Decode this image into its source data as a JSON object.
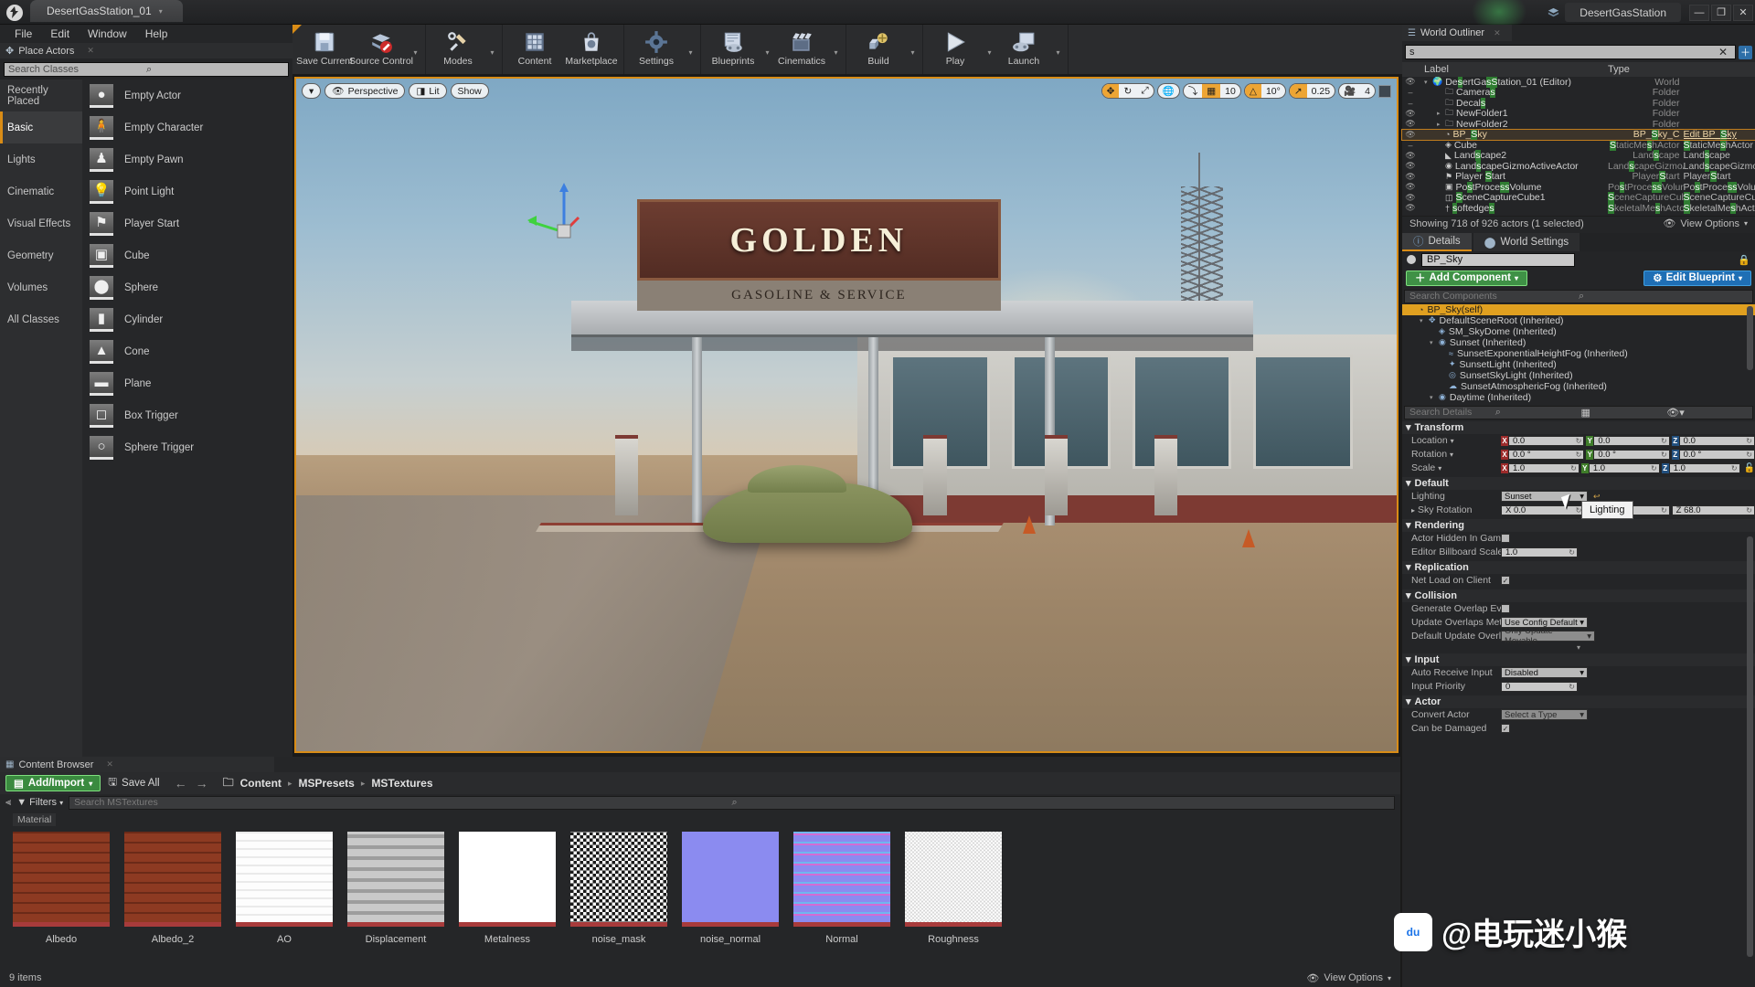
{
  "titlebar": {
    "tab_label": "DesertGasStation_01",
    "project_name": "DesertGasStation",
    "minimize": "—",
    "maximize": "❐",
    "close": "✕",
    "ue_logo_icon": "unreal-logo-icon"
  },
  "menubar": {
    "items": [
      "File",
      "Edit",
      "Window",
      "Help"
    ]
  },
  "toolbar": {
    "groups": [
      {
        "buttons": [
          {
            "label": "Save Current",
            "icon": "save-icon",
            "arrow": false
          },
          {
            "label": "Source Control",
            "icon": "source-control-icon",
            "arrow": true
          }
        ]
      },
      {
        "buttons": [
          {
            "label": "Modes",
            "icon": "modes-icon",
            "arrow": true
          }
        ]
      },
      {
        "buttons": [
          {
            "label": "Content",
            "icon": "content-icon",
            "arrow": false
          },
          {
            "label": "Marketplace",
            "icon": "marketplace-icon",
            "arrow": false
          }
        ]
      },
      {
        "buttons": [
          {
            "label": "Settings",
            "icon": "settings-icon",
            "arrow": true
          }
        ]
      },
      {
        "buttons": [
          {
            "label": "Blueprints",
            "icon": "blueprints-icon",
            "arrow": true
          },
          {
            "label": "Cinematics",
            "icon": "cinematics-icon",
            "arrow": true
          }
        ]
      },
      {
        "buttons": [
          {
            "label": "Build",
            "icon": "build-icon",
            "arrow": true
          }
        ]
      },
      {
        "buttons": [
          {
            "label": "Play",
            "icon": "play-icon",
            "arrow": true
          },
          {
            "label": "Launch",
            "icon": "launch-icon",
            "arrow": true
          }
        ]
      }
    ]
  },
  "place_actors": {
    "title": "Place Actors",
    "search_placeholder": "Search Classes",
    "categories": [
      {
        "label": "Recently Placed",
        "selected": false
      },
      {
        "label": "Basic",
        "selected": true
      },
      {
        "label": "Lights",
        "selected": false
      },
      {
        "label": "Cinematic",
        "selected": false
      },
      {
        "label": "Visual Effects",
        "selected": false
      },
      {
        "label": "Geometry",
        "selected": false
      },
      {
        "label": "Volumes",
        "selected": false
      },
      {
        "label": "All Classes",
        "selected": false
      }
    ],
    "items": [
      {
        "label": "Empty Actor",
        "glyph": "●"
      },
      {
        "label": "Empty Character",
        "glyph": "🧍"
      },
      {
        "label": "Empty Pawn",
        "glyph": "♟"
      },
      {
        "label": "Point Light",
        "glyph": "💡"
      },
      {
        "label": "Player Start",
        "glyph": "⚑"
      },
      {
        "label": "Cube",
        "glyph": "▣"
      },
      {
        "label": "Sphere",
        "glyph": "⬤"
      },
      {
        "label": "Cylinder",
        "glyph": "▮"
      },
      {
        "label": "Cone",
        "glyph": "▲"
      },
      {
        "label": "Plane",
        "glyph": "▬"
      },
      {
        "label": "Box Trigger",
        "glyph": "◻"
      },
      {
        "label": "Sphere Trigger",
        "glyph": "○"
      }
    ]
  },
  "viewport": {
    "left_controls": {
      "menu_caret": "▾",
      "perspective": "Perspective",
      "lit": "Lit",
      "show": "Show"
    },
    "right_controls": {
      "translate_icon": "translate-gizmo-icon",
      "rotate_icon": "rotate-gizmo-icon",
      "scale_icon": "scale-gizmo-icon",
      "world_icon": "world-space-icon",
      "surface_snap_icon": "surface-snap-icon",
      "grid_snap_icon": "grid-snap-icon",
      "grid_snap_value": "10",
      "angle_snap_icon": "angle-snap-icon",
      "angle_snap_value": "10°",
      "scale_snap_icon": "scale-snap-icon",
      "scale_snap_value": "0.25",
      "camera_speed_icon": "camera-speed-icon",
      "camera_speed_value": "4",
      "maximize_icon": "maximize-viewport-icon"
    },
    "scene": {
      "sign_text": "GOLDEN",
      "sign_sub": "GASOLINE & SERVICE"
    }
  },
  "content_browser": {
    "tab_title": "Content Browser",
    "add_import": "Add/Import",
    "save_all": "Save All",
    "breadcrumb": [
      "Content",
      "MSPresets",
      "MSTextures"
    ],
    "filters_label": "Filters",
    "search_placeholder": "Search MSTextures",
    "section_label": "Material",
    "assets": [
      {
        "name": "Albedo",
        "style": "brick"
      },
      {
        "name": "Albedo_2",
        "style": "brick"
      },
      {
        "name": "AO",
        "style": "ao"
      },
      {
        "name": "Displacement",
        "style": "disp"
      },
      {
        "name": "Metalness",
        "style": "white"
      },
      {
        "name": "noise_mask",
        "style": "noise"
      },
      {
        "name": "noise_normal",
        "style": "periwinkle"
      },
      {
        "name": "Normal",
        "style": "normal"
      },
      {
        "name": "Roughness",
        "style": "rough"
      }
    ],
    "item_count": "9 items",
    "view_options": "View Options"
  },
  "world_outliner": {
    "tab_title": "World Outliner",
    "search_value": "s",
    "clear_icon": "clear-search-icon",
    "add_icon": "add-outliner-icon",
    "columns": {
      "label": "Label",
      "type": "Type"
    },
    "rows": [
      {
        "label": "DesertGasStation_01 (Editor)",
        "type": "World",
        "type2": "",
        "icon": "world-icon",
        "indent": 0,
        "eye": true,
        "expander": "▾",
        "selected": false
      },
      {
        "label": "Cameras",
        "type": "Folder",
        "type2": "",
        "icon": "folder-icon",
        "indent": 1,
        "eye": false,
        "expander": "",
        "selected": false
      },
      {
        "label": "Decals",
        "type": "Folder",
        "type2": "",
        "icon": "folder-icon",
        "indent": 1,
        "eye": false,
        "expander": "",
        "selected": false
      },
      {
        "label": "NewFolder1",
        "type": "Folder",
        "type2": "",
        "icon": "folder-icon",
        "indent": 1,
        "eye": true,
        "expander": "▸",
        "selected": false
      },
      {
        "label": "NewFolder2",
        "type": "Folder",
        "type2": "",
        "icon": "folder-icon",
        "indent": 1,
        "eye": true,
        "expander": "▸",
        "selected": false
      },
      {
        "label": "BP_Sky",
        "type": "BP_Sky_C",
        "type2": "Edit BP_Sky",
        "icon": "blueprint-icon",
        "indent": 1,
        "eye": true,
        "expander": "",
        "selected": true
      },
      {
        "label": "Cube",
        "type": "StaticMeshActor",
        "type2": "StaticMeshActor",
        "icon": "mesh-icon",
        "indent": 1,
        "eye": false,
        "expander": "",
        "selected": false
      },
      {
        "label": "Landscape2",
        "type": "Landscape",
        "type2": "Landscape",
        "icon": "landscape-icon",
        "indent": 1,
        "eye": true,
        "expander": "",
        "selected": false
      },
      {
        "label": "LandscapeGizmoActiveActor",
        "type": "LandscapeGizmoActiveActor",
        "type2": "LandscapeGizmoActiveA",
        "icon": "gizmo-icon",
        "indent": 1,
        "eye": true,
        "expander": "",
        "selected": false
      },
      {
        "label": "Player Start",
        "type": "PlayerStart",
        "type2": "PlayerStart",
        "icon": "playerstart-icon",
        "indent": 1,
        "eye": true,
        "expander": "",
        "selected": false
      },
      {
        "label": "PostProcessVolume",
        "type": "PostProcessVolume",
        "type2": "PostProcessVolume",
        "icon": "volume-icon",
        "indent": 1,
        "eye": true,
        "expander": "",
        "selected": false
      },
      {
        "label": "SceneCaptureCube1",
        "type": "SceneCaptureCube",
        "type2": "SceneCaptureCube",
        "icon": "capture-icon",
        "indent": 1,
        "eye": true,
        "expander": "",
        "selected": false
      },
      {
        "label": "softedges",
        "type": "SkeletalMeshActor",
        "type2": "SkeletalMeshActor",
        "icon": "skeletal-icon",
        "indent": 1,
        "eye": true,
        "expander": "",
        "selected": false
      }
    ],
    "status": "Showing 718 of 926 actors (1 selected)",
    "view_options": "View Options"
  },
  "details": {
    "tabs": [
      {
        "label": "Details",
        "selected": true,
        "icon": "details-icon"
      },
      {
        "label": "World Settings",
        "selected": false,
        "icon": "world-settings-icon"
      }
    ],
    "actor_name": "BP_Sky",
    "lock_icon": "lock-details-icon",
    "add_component": "Add Component",
    "edit_blueprint": "Edit Blueprint",
    "component_search_placeholder": "Search Components",
    "components": [
      {
        "label": "BP_Sky(self)",
        "indent": 0,
        "selected": true,
        "expander": "",
        "icon": "blueprint-icon"
      },
      {
        "label": "DefaultSceneRoot (Inherited)",
        "indent": 1,
        "selected": false,
        "expander": "▾",
        "icon": "scene-root-icon"
      },
      {
        "label": "SM_SkyDome (Inherited)",
        "indent": 2,
        "selected": false,
        "expander": "",
        "icon": "static-mesh-icon"
      },
      {
        "label": "Sunset (Inherited)",
        "indent": 2,
        "selected": false,
        "expander": "▾",
        "icon": "scene-component-icon"
      },
      {
        "label": "SunsetExponentialHeightFog (Inherited)",
        "indent": 3,
        "selected": false,
        "expander": "",
        "icon": "fog-icon"
      },
      {
        "label": "SunsetLight (Inherited)",
        "indent": 3,
        "selected": false,
        "expander": "",
        "icon": "light-icon"
      },
      {
        "label": "SunsetSkyLight (Inherited)",
        "indent": 3,
        "selected": false,
        "expander": "",
        "icon": "skylight-icon"
      },
      {
        "label": "SunsetAtmosphericFog (Inherited)",
        "indent": 3,
        "selected": false,
        "expander": "",
        "icon": "atmospheric-fog-icon"
      },
      {
        "label": "Daytime (Inherited)",
        "indent": 2,
        "selected": false,
        "expander": "▾",
        "icon": "scene-component-icon"
      }
    ],
    "details_search_placeholder": "Search Details",
    "grid_icon": "grid-view-icon",
    "eye_icon": "display-options-icon",
    "sections": {
      "transform": {
        "title": "Transform",
        "location": {
          "label": "Location",
          "x": "0.0",
          "y": "0.0",
          "z": "0.0"
        },
        "rotation": {
          "label": "Rotation",
          "x": "0.0 °",
          "y": "0.0 °",
          "z": "0.0 °"
        },
        "scale": {
          "label": "Scale",
          "x": "1.0",
          "y": "1.0",
          "z": "1.0"
        }
      },
      "default": {
        "title": "Default",
        "lighting": {
          "label": "Lighting",
          "value": "Sunset"
        },
        "sky_rotation": {
          "label": "Sky Rotation",
          "x": "X 0.0",
          "y": "0",
          "z": "Z 68.0"
        }
      },
      "rendering": {
        "title": "Rendering",
        "actor_hidden_in_game": {
          "label": "Actor Hidden In Game",
          "checked": false
        },
        "editor_billboard_scale": {
          "label": "Editor Billboard Scale",
          "value": "1.0"
        }
      },
      "replication": {
        "title": "Replication",
        "net_load_on_client": {
          "label": "Net Load on Client",
          "checked": true
        }
      },
      "collision": {
        "title": "Collision",
        "generate_overlap": {
          "label": "Generate Overlap Events During",
          "checked": false
        },
        "update_overlaps_during": {
          "label": "Update Overlaps Method During",
          "value": "Use Config Default"
        },
        "default_update_overlaps": {
          "label": "Default Update Overlaps Metho",
          "value": "Only Update Movable"
        }
      },
      "input": {
        "title": "Input",
        "auto_receive_input": {
          "label": "Auto Receive Input",
          "value": "Disabled"
        },
        "input_priority": {
          "label": "Input Priority",
          "value": "0"
        }
      },
      "actor": {
        "title": "Actor",
        "convert_actor": {
          "label": "Convert Actor",
          "value": "Select a Type"
        },
        "can_be_damaged": {
          "label": "Can be Damaged",
          "checked": true
        }
      }
    },
    "tooltip": "Lighting"
  },
  "watermark": {
    "text": "@电玩迷小猴",
    "logo": "baidu-logo-icon"
  },
  "colors": {
    "accent_orange": "#d98c16",
    "green_button": "#3f9146",
    "blue_button": "#1f6fb5",
    "selection_highlight": "#e0a020",
    "search_match": "#2f7d32"
  }
}
